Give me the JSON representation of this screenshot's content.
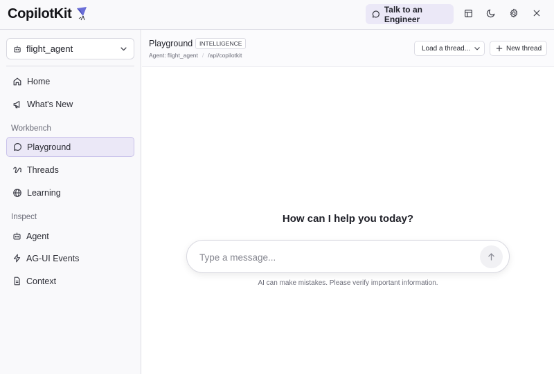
{
  "app": {
    "logo_text": "CopilotKit",
    "talk_button": "Talk to an Engineer",
    "icons": [
      "chat-bubble-icon",
      "layout-icon",
      "moon-icon",
      "gear-icon",
      "close-icon"
    ]
  },
  "sidebar": {
    "agent_select": {
      "value": "flight_agent",
      "icon": "bot-icon"
    },
    "top_items": [
      {
        "label": "Home",
        "icon": "home-icon"
      },
      {
        "label": "What's New",
        "icon": "megaphone-icon"
      }
    ],
    "sections": [
      {
        "label": "Workbench",
        "items": [
          {
            "label": "Playground",
            "icon": "chat-bubble-icon",
            "active": true
          },
          {
            "label": "Threads",
            "icon": "threads-icon"
          },
          {
            "label": "Learning",
            "icon": "globe-icon"
          }
        ]
      },
      {
        "label": "Inspect",
        "items": [
          {
            "label": "Agent",
            "icon": "bot-icon"
          },
          {
            "label": "AG-UI Events",
            "icon": "zap-icon"
          },
          {
            "label": "Context",
            "icon": "document-icon"
          }
        ]
      }
    ]
  },
  "header": {
    "title": "Playground",
    "badge": "INTELLIGENCE",
    "agent_line": "Agent: flight_agent",
    "endpoint": "/api/copilotkit",
    "load_thread": "Load a thread...",
    "new_thread": "New thread"
  },
  "chat": {
    "welcome": "How can I help you today?",
    "placeholder": "Type a message...",
    "disclaimer": "AI can make mistakes. Please verify important information."
  },
  "colors": {
    "accent_bg": "#ebe8f7",
    "accent_border": "#c9c2ea",
    "sidebar_bg": "#f9f9fb"
  }
}
